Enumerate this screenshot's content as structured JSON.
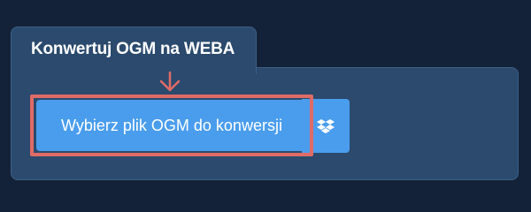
{
  "converter": {
    "tab_title": "Konwertuj OGM na WEBA",
    "choose_file_label": "Wybierz plik OGM do konwersji",
    "dropbox_icon": "dropbox-icon",
    "pointer_icon": "arrow-down-icon"
  },
  "colors": {
    "page_background": "#132238",
    "panel_background": "#2b4a6d",
    "button_background": "#4a9ded",
    "highlight": "#df6b66"
  }
}
